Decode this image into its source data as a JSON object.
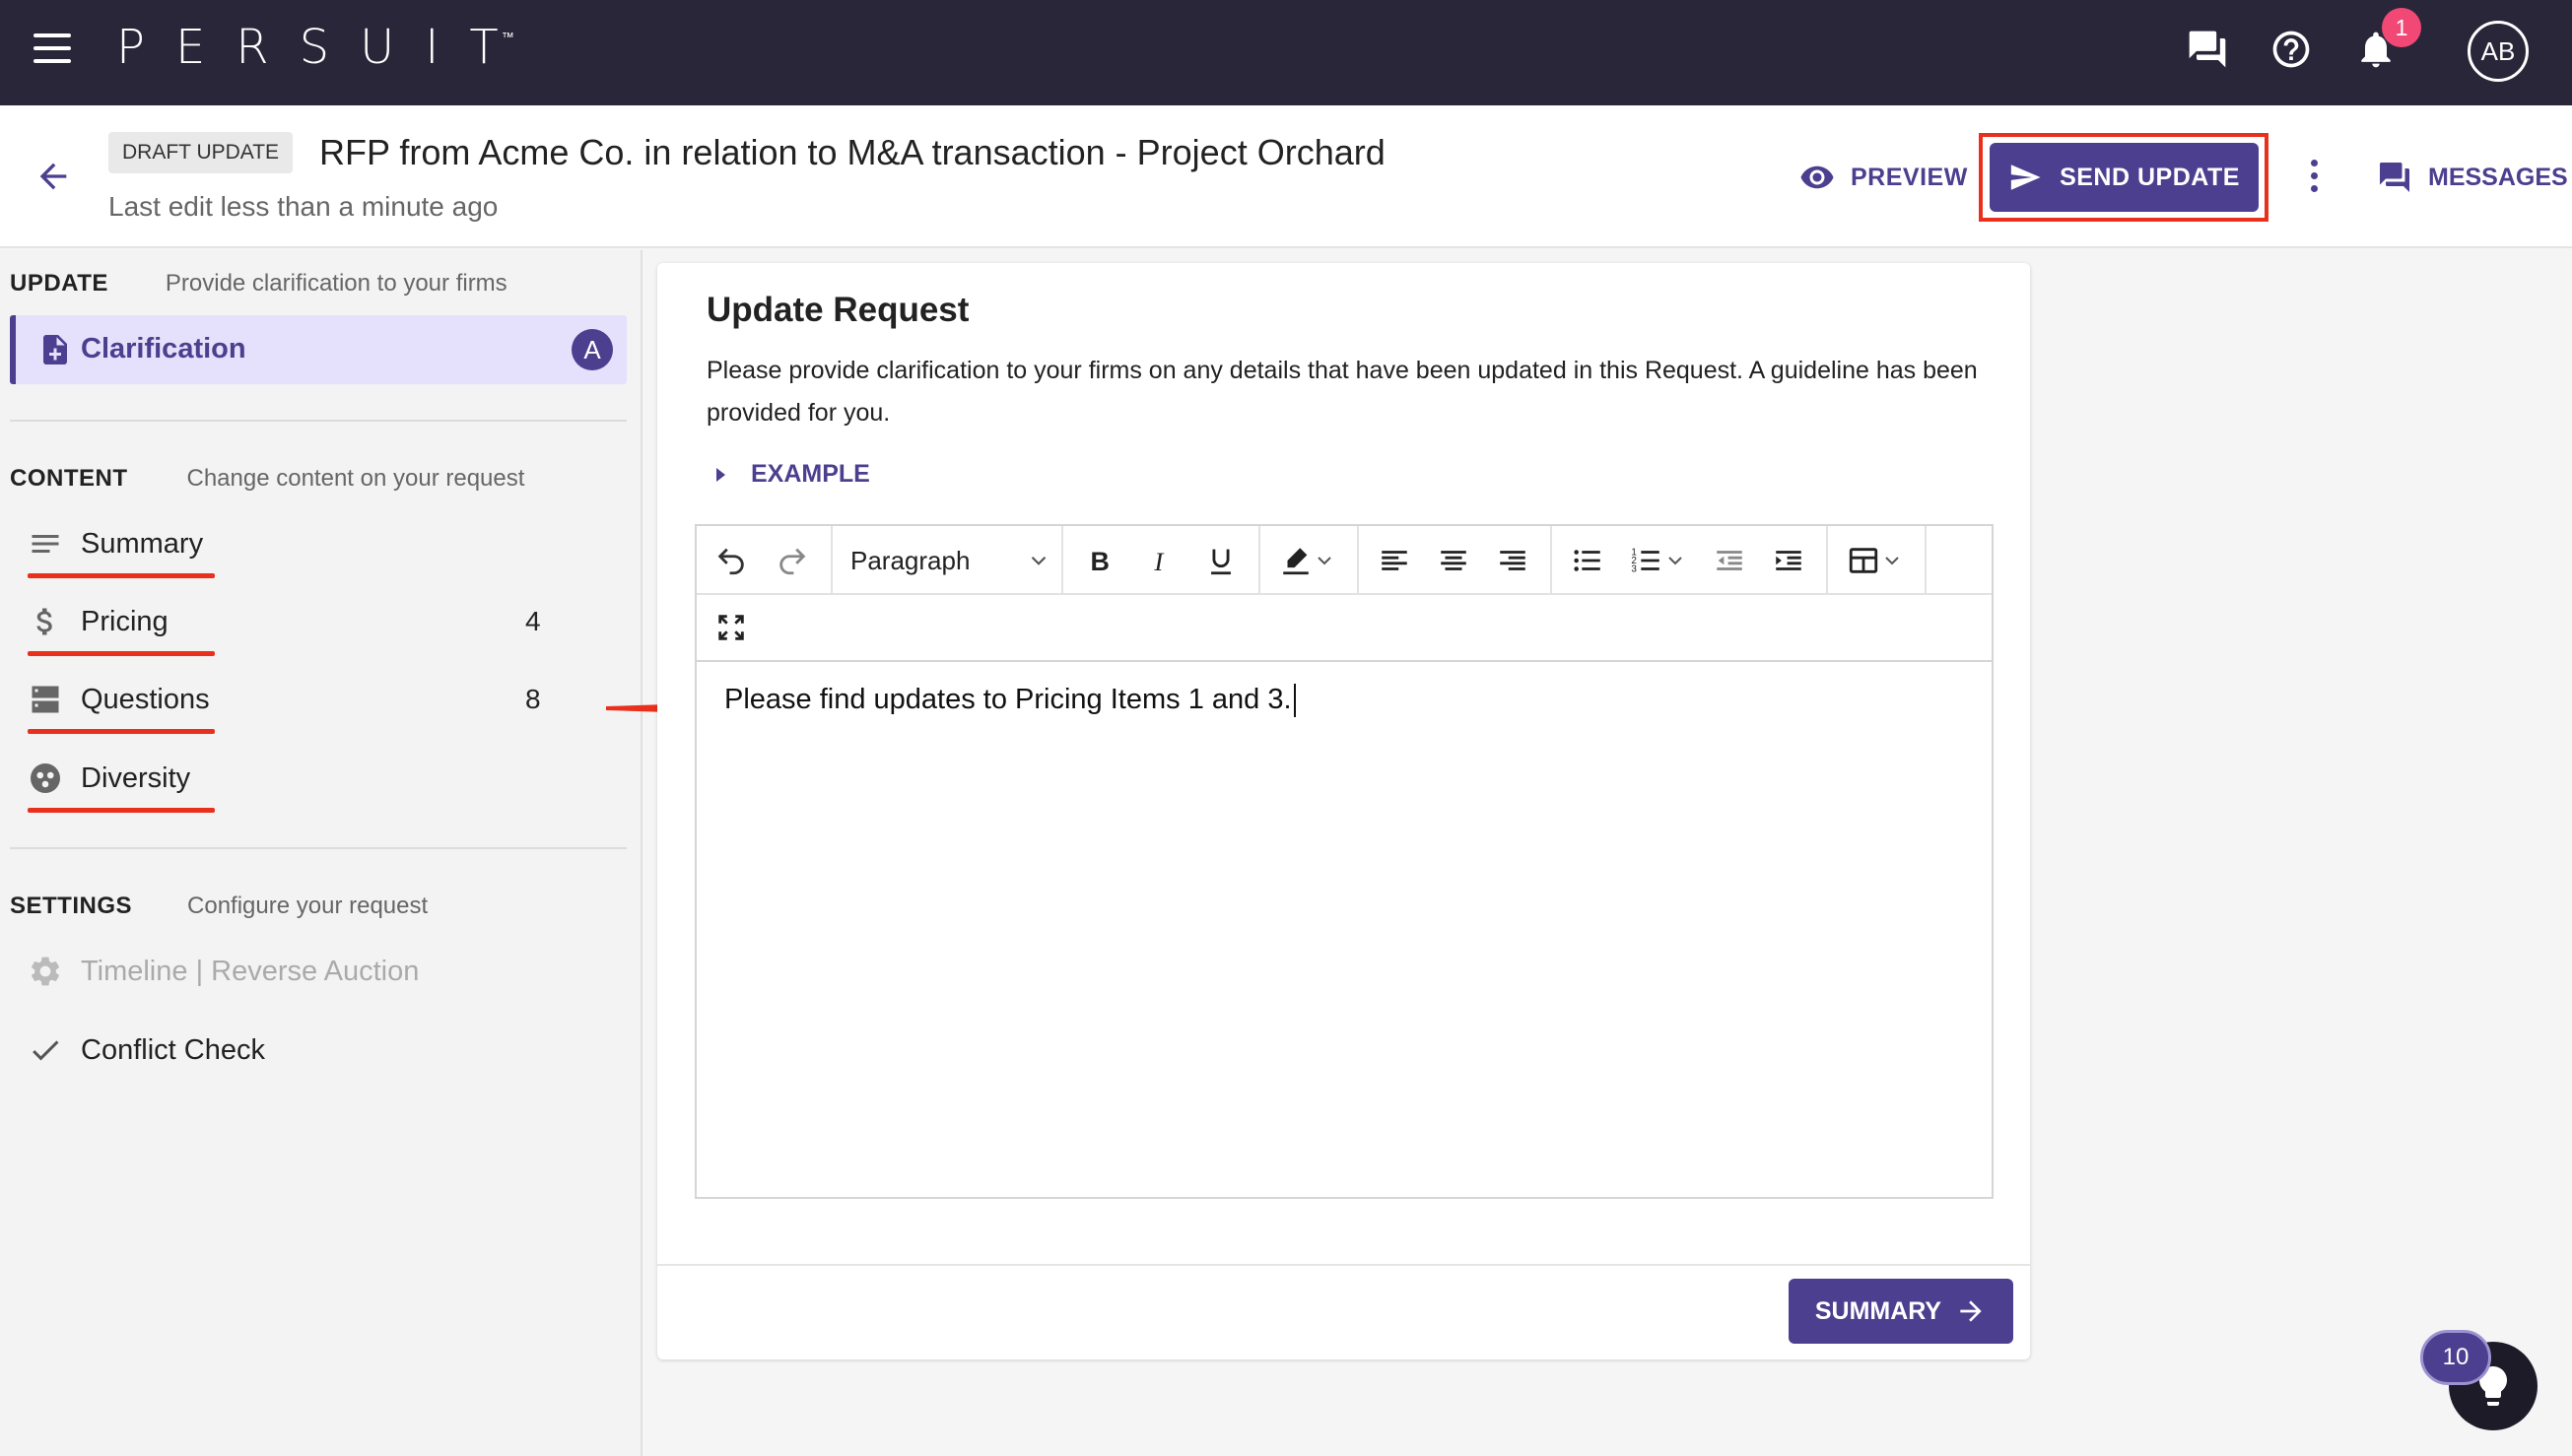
{
  "app": {
    "logo": "PERSUIT",
    "logo_tm": "™"
  },
  "topnav": {
    "notification_count": "1",
    "avatar_initials": "AB",
    "icons": [
      "menu-icon",
      "chat-icon",
      "help-icon",
      "bell-icon"
    ]
  },
  "header": {
    "status_chip": "DRAFT UPDATE",
    "title": "RFP from Acme Co. in relation to M&A transaction - Project Orchard",
    "last_edit": "Last edit less than a minute ago",
    "preview_label": "PREVIEW",
    "send_update_label": "SEND UPDATE",
    "messages_label": "MESSAGES"
  },
  "sidebar": {
    "update": {
      "heading": "UPDATE",
      "subheading": "Provide clarification to your firms",
      "item_label": "Clarification",
      "item_badge": "A"
    },
    "content": {
      "heading": "CONTENT",
      "subheading": "Change content on your request",
      "items": [
        {
          "label": "Summary",
          "count": "",
          "icon": "lines-icon"
        },
        {
          "label": "Pricing",
          "count": "4",
          "icon": "dollar-icon"
        },
        {
          "label": "Questions",
          "count": "8",
          "icon": "server-icon"
        },
        {
          "label": "Diversity",
          "count": "",
          "icon": "diversity-icon"
        }
      ]
    },
    "settings": {
      "heading": "SETTINGS",
      "subheading": "Configure your request",
      "items": [
        {
          "label": "Timeline | Reverse Auction",
          "icon": "gear-icon",
          "disabled": true
        },
        {
          "label": "Conflict Check",
          "icon": "check-icon",
          "disabled": false
        }
      ]
    }
  },
  "main": {
    "title": "Update Request",
    "description": "Please provide clarification to your firms on any details that have been updated in this Request. A guideline has been provided for you.",
    "example_label": "EXAMPLE",
    "editor": {
      "block_format": "Paragraph",
      "body_text": "Please find updates to Pricing Items 1 and 3."
    },
    "summary_button": "SUMMARY"
  },
  "help_widget": {
    "count": "10"
  },
  "colors": {
    "brand": "#4c3f8f",
    "nav_bg": "#2a2639",
    "highlight_red": "#e8301c",
    "badge_pink": "#f24876",
    "selected_bg": "#e5e0fb"
  }
}
